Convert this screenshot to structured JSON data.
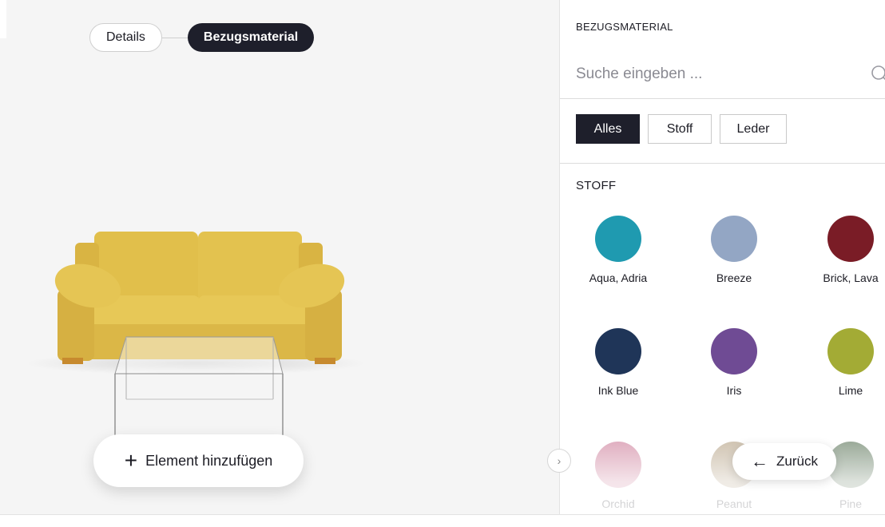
{
  "steps": {
    "details_label": "Details",
    "material_label": "Bezugsmaterial"
  },
  "add_element_label": "Element hinzufügen",
  "panel": {
    "title": "BEZUGSMATERIAL",
    "search_placeholder": "Suche eingeben ...",
    "filters": [
      "Alles",
      "Stoff",
      "Leder"
    ],
    "active_filter": "Alles",
    "section_title": "STOFF",
    "swatches": [
      {
        "name": "Aqua, Adria",
        "color": "#1f9ab0"
      },
      {
        "name": "Breeze",
        "color": "#93a6c4"
      },
      {
        "name": "Brick, Lava",
        "color": "#7a1c26"
      },
      {
        "name": "Ink Blue",
        "color": "#1f3558"
      },
      {
        "name": "Iris",
        "color": "#6f4b94"
      },
      {
        "name": "Lime",
        "color": "#a3ab35"
      },
      {
        "name": "Orchid",
        "color": "#dba2b6"
      },
      {
        "name": "Peanut",
        "color": "#c9bba6"
      },
      {
        "name": "Pine",
        "color": "#8a9c88"
      }
    ]
  },
  "back_label": "Zurück",
  "colors": {
    "accent_dark": "#1e1f2b",
    "sofa": "#e3c24e"
  }
}
